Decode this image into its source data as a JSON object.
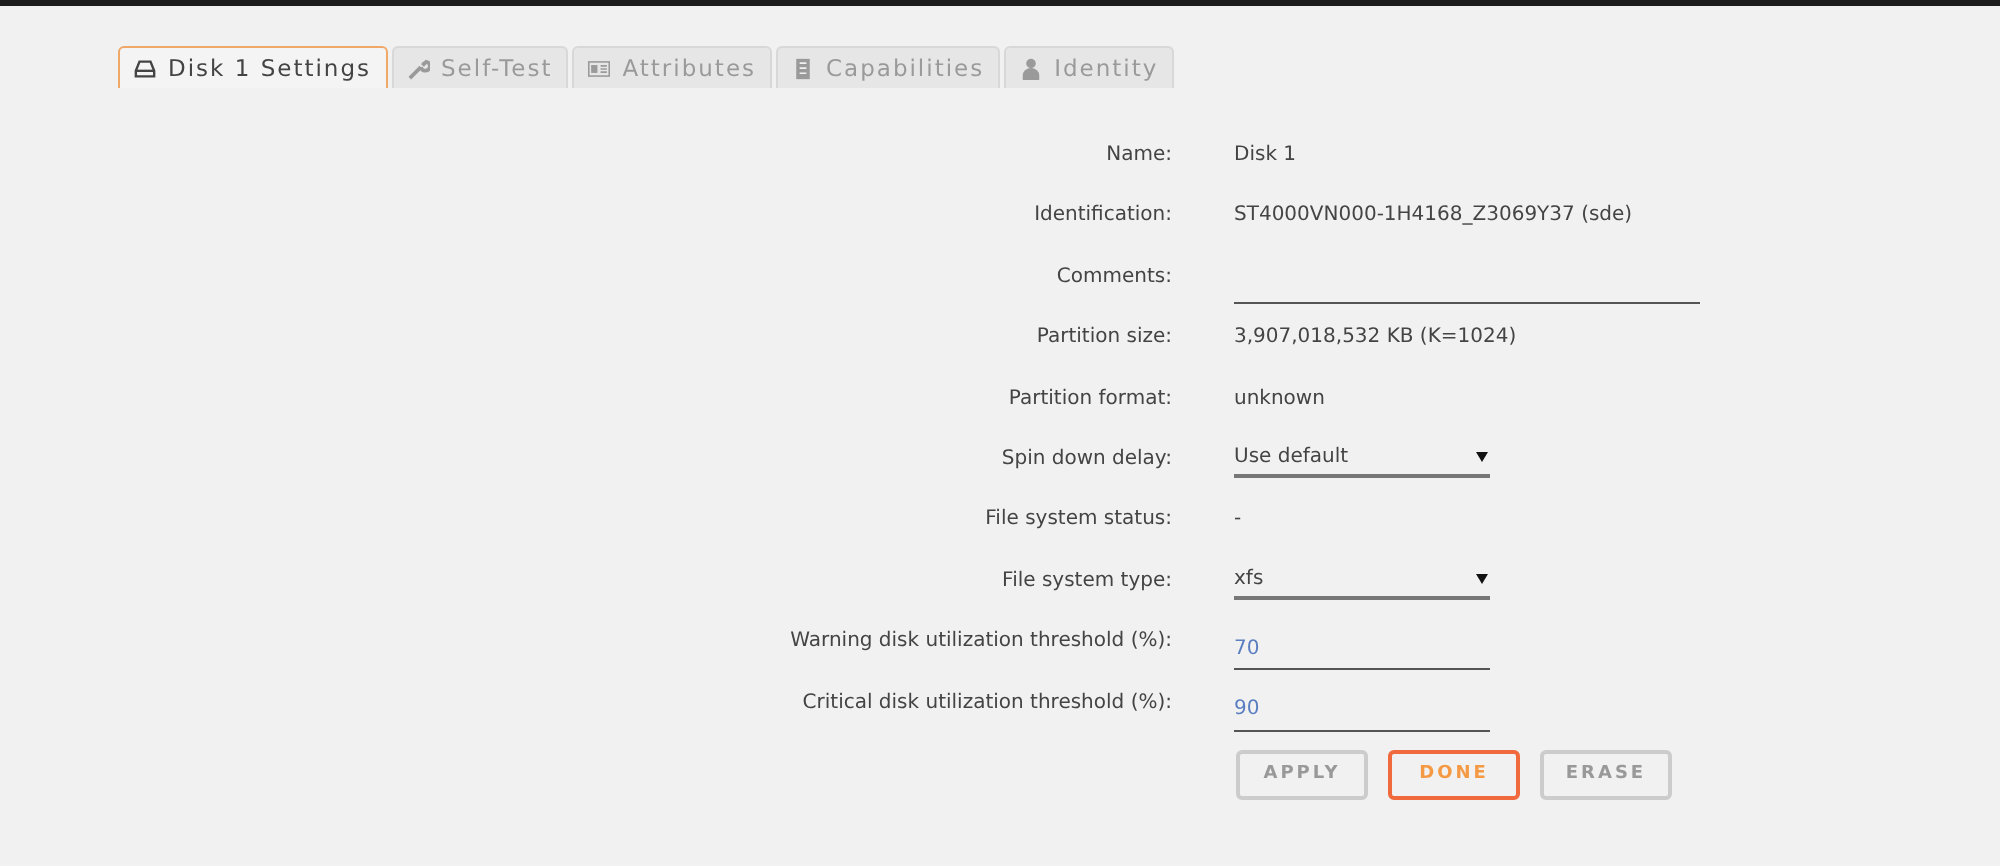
{
  "tabs": [
    {
      "label": "Disk 1 Settings",
      "kind": "disk",
      "selected": true
    },
    {
      "label": "Self-Test",
      "kind": "wrench",
      "selected": false
    },
    {
      "label": "Attributes",
      "kind": "card",
      "selected": false
    },
    {
      "label": "Capabilities",
      "kind": "server",
      "selected": false
    },
    {
      "label": "Identity",
      "kind": "user",
      "selected": false
    }
  ],
  "fields": [
    {
      "label": "Name:",
      "kind": "text",
      "value": "Disk 1"
    },
    {
      "label": "Identification:",
      "kind": "text",
      "value": "ST4000VN000-1H4168_Z3069Y37 (sde)"
    },
    {
      "label": "Comments:",
      "kind": "wide"
    },
    {
      "label": "Partition size:",
      "kind": "text",
      "value": "3,907,018,532 KB (K=1024)"
    },
    {
      "label": "Partition format:",
      "kind": "text",
      "value": "unknown"
    },
    {
      "label": "Spin down delay:",
      "kind": "select",
      "value": "Use default"
    },
    {
      "label": "File system status:",
      "kind": "text",
      "value": "-"
    },
    {
      "label": "File system type:",
      "kind": "select",
      "value": "xfs"
    },
    {
      "label": "Warning disk utilization threshold (%):",
      "kind": "input",
      "value": "70"
    },
    {
      "label": "Critical disk utilization threshold (%):",
      "kind": "input",
      "value": "90"
    }
  ],
  "buttons": [
    {
      "label": "APPLY",
      "disabled": true,
      "primary": false
    },
    {
      "label": "DONE",
      "disabled": false,
      "primary": true
    },
    {
      "label": "ERASE",
      "disabled": true,
      "primary": false
    }
  ]
}
